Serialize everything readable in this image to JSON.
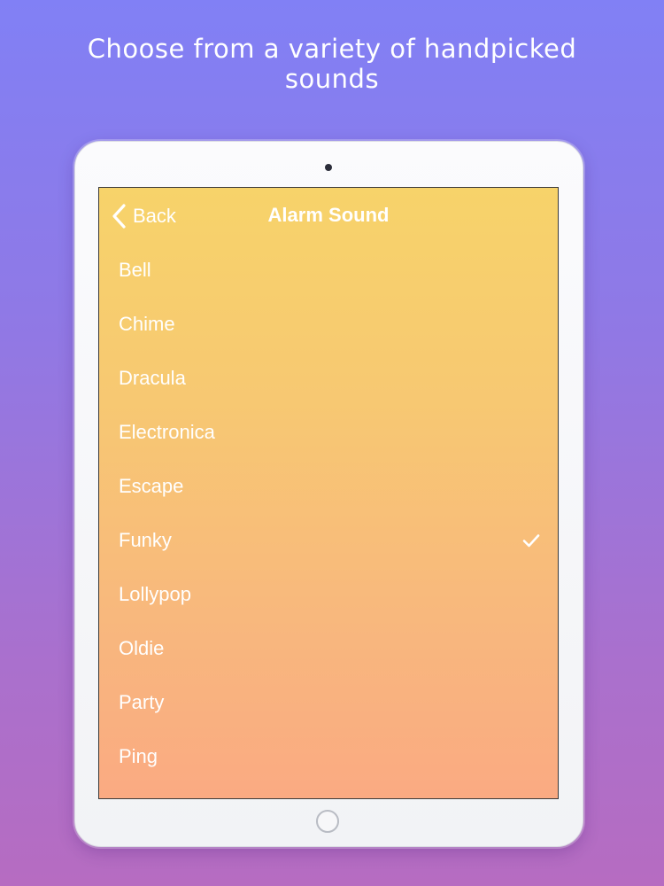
{
  "headline": {
    "line1": "Choose from a variety of handpicked",
    "line2": "sounds"
  },
  "navbar": {
    "back_label": "Back",
    "back_icon": "chevron-left-icon",
    "title": "Alarm Sound"
  },
  "sounds": [
    {
      "name": "Bell",
      "selected": false
    },
    {
      "name": "Chime",
      "selected": false
    },
    {
      "name": "Dracula",
      "selected": false
    },
    {
      "name": "Electronica",
      "selected": false
    },
    {
      "name": "Escape",
      "selected": false
    },
    {
      "name": "Funky",
      "selected": true
    },
    {
      "name": "Lollypop",
      "selected": false
    },
    {
      "name": "Oldie",
      "selected": false
    },
    {
      "name": "Party",
      "selected": false
    },
    {
      "name": "Ping",
      "selected": false
    }
  ],
  "selected_icon": "checkmark-icon",
  "colors": {
    "background_top": "#8180F5",
    "background_bottom": "#B66CC1",
    "screen_top": "#F7D36A",
    "screen_bottom": "#FAAA82",
    "text": "#FFFFFF"
  }
}
